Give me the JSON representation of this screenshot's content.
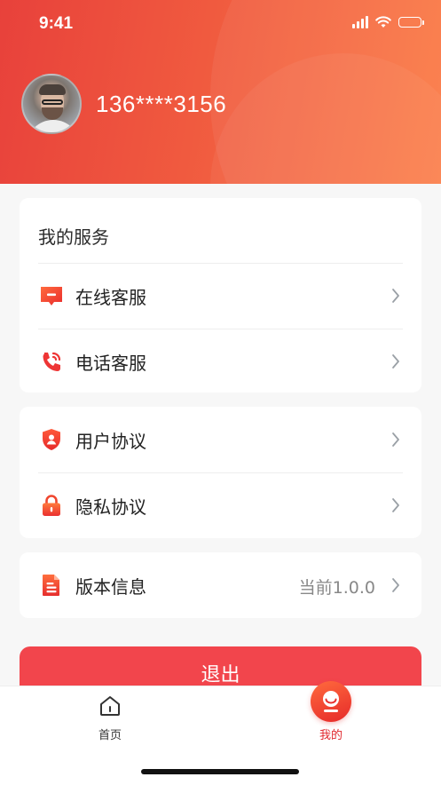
{
  "status_bar": {
    "time": "9:41"
  },
  "profile": {
    "phone": "136****3156"
  },
  "services": {
    "title": "我的服务",
    "items": [
      {
        "label": "在线客服",
        "icon": "chat-support-icon"
      },
      {
        "label": "电话客服",
        "icon": "phone-call-icon"
      }
    ]
  },
  "agreements": {
    "items": [
      {
        "label": "用户协议",
        "icon": "user-shield-icon"
      },
      {
        "label": "隐私协议",
        "icon": "lock-icon"
      }
    ]
  },
  "version": {
    "label": "版本信息",
    "value": "当前1.0.0",
    "icon": "document-icon"
  },
  "logout": {
    "label": "退出"
  },
  "tabbar": {
    "items": [
      {
        "label": "首页",
        "icon": "home-icon",
        "active": false
      },
      {
        "label": "我的",
        "icon": "profile-face-icon",
        "active": true
      }
    ]
  },
  "colors": {
    "accent": "#f2454c",
    "header_start": "#e8413b",
    "header_end": "#fb7b46",
    "active_tab": "#e0282e",
    "inactive_tab": "#333333"
  }
}
